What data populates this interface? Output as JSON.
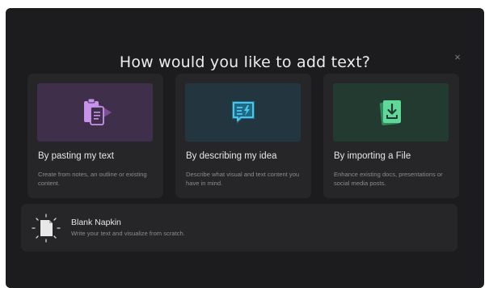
{
  "dialog": {
    "title": "How would you like to add text?",
    "close_label": "×"
  },
  "options": [
    {
      "title": "By pasting my text",
      "description": "Create from notes, an outline or existing content.",
      "icon": "clipboard-paste-icon",
      "thumb_color": "#3f2f4a",
      "accent_color": "#c792ea"
    },
    {
      "title": "By describing my idea",
      "description": "Describe what visual and text content you have in mind.",
      "icon": "chat-bubble-lightning-icon",
      "thumb_color": "#233640",
      "accent_color": "#4fc3e8"
    },
    {
      "title": "By importing a File",
      "description": "Enhance existing docs, presentations or social media posts.",
      "icon": "file-import-icon",
      "thumb_color": "#233a30",
      "accent_color": "#5fd89a"
    }
  ],
  "blank": {
    "title": "Blank Napkin",
    "description": "Write your text and visualize from scratch.",
    "icon": "blank-page-sparkle-icon"
  }
}
